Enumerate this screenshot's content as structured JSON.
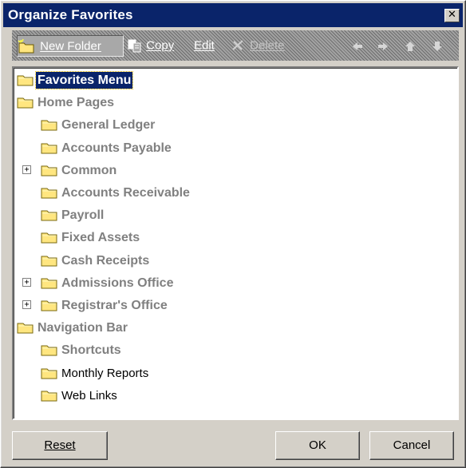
{
  "window": {
    "title": "Organize Favorites"
  },
  "toolbar": {
    "new_folder": "New Folder",
    "copy": "Copy",
    "edit": "Edit",
    "delete": "Delete",
    "arrows": [
      "arrow-left-icon",
      "arrow-right-icon",
      "arrow-up-icon",
      "arrow-down-icon"
    ]
  },
  "tree": {
    "items": [
      {
        "label": "Favorites Menu",
        "level": 0,
        "expandable": false,
        "selected": true,
        "bold": true
      },
      {
        "label": "Home Pages",
        "level": 0,
        "expandable": false,
        "selected": false,
        "bold": true
      },
      {
        "label": "General Ledger",
        "level": 1,
        "expandable": false,
        "selected": false,
        "bold": true
      },
      {
        "label": "Accounts Payable",
        "level": 1,
        "expandable": false,
        "selected": false,
        "bold": true
      },
      {
        "label": "Common",
        "level": 1,
        "expandable": true,
        "selected": false,
        "bold": true
      },
      {
        "label": "Accounts Receivable",
        "level": 1,
        "expandable": false,
        "selected": false,
        "bold": true
      },
      {
        "label": "Payroll",
        "level": 1,
        "expandable": false,
        "selected": false,
        "bold": true
      },
      {
        "label": "Fixed Assets",
        "level": 1,
        "expandable": false,
        "selected": false,
        "bold": true
      },
      {
        "label": "Cash Receipts",
        "level": 1,
        "expandable": false,
        "selected": false,
        "bold": true
      },
      {
        "label": "Admissions Office",
        "level": 1,
        "expandable": true,
        "selected": false,
        "bold": true
      },
      {
        "label": "Registrar's Office",
        "level": 1,
        "expandable": true,
        "selected": false,
        "bold": true
      },
      {
        "label": "Navigation Bar",
        "level": 0,
        "expandable": false,
        "selected": false,
        "bold": true
      },
      {
        "label": "Shortcuts",
        "level": 1,
        "expandable": false,
        "selected": false,
        "bold": true
      },
      {
        "label": "Monthly Reports",
        "level": 1,
        "expandable": false,
        "selected": false,
        "bold": false
      },
      {
        "label": "Web Links",
        "level": 1,
        "expandable": false,
        "selected": false,
        "bold": false
      }
    ]
  },
  "footer": {
    "reset": "Reset",
    "ok": "OK",
    "cancel": "Cancel"
  },
  "colors": {
    "titlebar": "#0a246a",
    "selection": "#0a246a",
    "folder": "#ffe680",
    "dialog": "#d4d0c8"
  }
}
